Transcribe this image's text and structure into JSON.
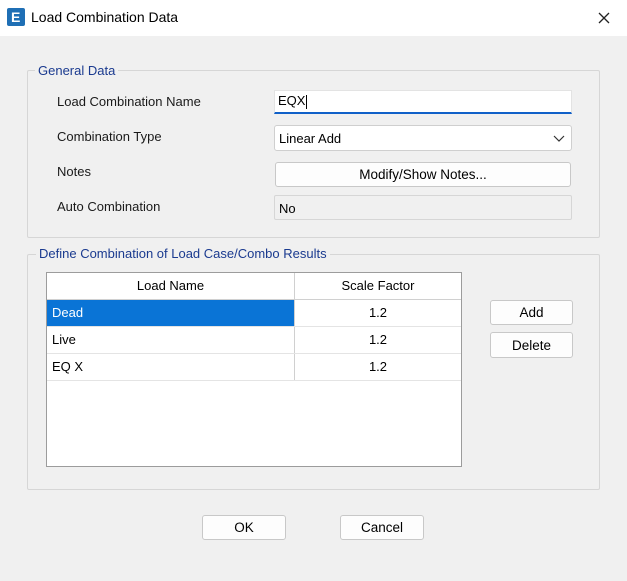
{
  "window": {
    "title": "Load Combination Data",
    "icon_letter": "E"
  },
  "general": {
    "legend": "General Data",
    "name_label": "Load Combination Name",
    "name_value": "EQX",
    "type_label": "Combination Type",
    "type_value": "Linear Add",
    "notes_label": "Notes",
    "notes_button": "Modify/Show Notes...",
    "auto_label": "Auto Combination",
    "auto_value": "No"
  },
  "define": {
    "legend": "Define Combination of Load Case/Combo Results",
    "columns": [
      "Load Name",
      "Scale Factor"
    ],
    "rows": [
      {
        "name": "Dead",
        "factor": "1.2",
        "selected": true
      },
      {
        "name": "Live",
        "factor": "1.2",
        "selected": false
      },
      {
        "name": "EQ X",
        "factor": "1.2",
        "selected": false
      }
    ],
    "add_button": "Add",
    "delete_button": "Delete"
  },
  "footer": {
    "ok_button": "OK",
    "cancel_button": "Cancel"
  },
  "colors": {
    "accent": "#0a74d6",
    "legend_text": "#1a3a8f",
    "app_icon": "#1f6fb5"
  }
}
